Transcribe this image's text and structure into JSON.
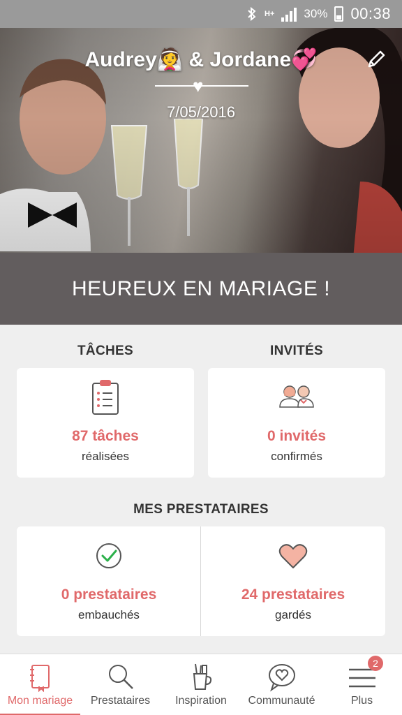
{
  "status_bar": {
    "network": "H+",
    "battery_percent": "30%",
    "time": "00:38"
  },
  "hero": {
    "title": "Audrey👰 & Jordane💞",
    "date": "7/05/2016"
  },
  "banner": {
    "text": "HEUREUX EN MARIAGE !"
  },
  "tasks": {
    "label": "TÂCHES",
    "value": "87 tâches",
    "sub": "réalisées"
  },
  "guests": {
    "label": "INVITÉS",
    "value": "0 invités",
    "sub": "confirmés"
  },
  "vendors": {
    "label": "MES PRESTATAIRES",
    "hired": {
      "value": "0 prestataires",
      "sub": "embauchés"
    },
    "saved": {
      "value": "24 prestataires",
      "sub": "gardés"
    }
  },
  "bottom_nav": {
    "items": [
      {
        "label": "Mon mariage",
        "icon": "notebook-icon",
        "active": true
      },
      {
        "label": "Prestataires",
        "icon": "search-icon",
        "active": false
      },
      {
        "label": "Inspiration",
        "icon": "cup-icon",
        "active": false
      },
      {
        "label": "Communauté",
        "icon": "chat-heart-icon",
        "active": false
      },
      {
        "label": "Plus",
        "icon": "menu-icon",
        "active": false
      }
    ],
    "plus_badge": "2"
  },
  "colors": {
    "accent": "#e0696a",
    "banner_bg": "#625d5e",
    "page_bg": "#efefef"
  }
}
